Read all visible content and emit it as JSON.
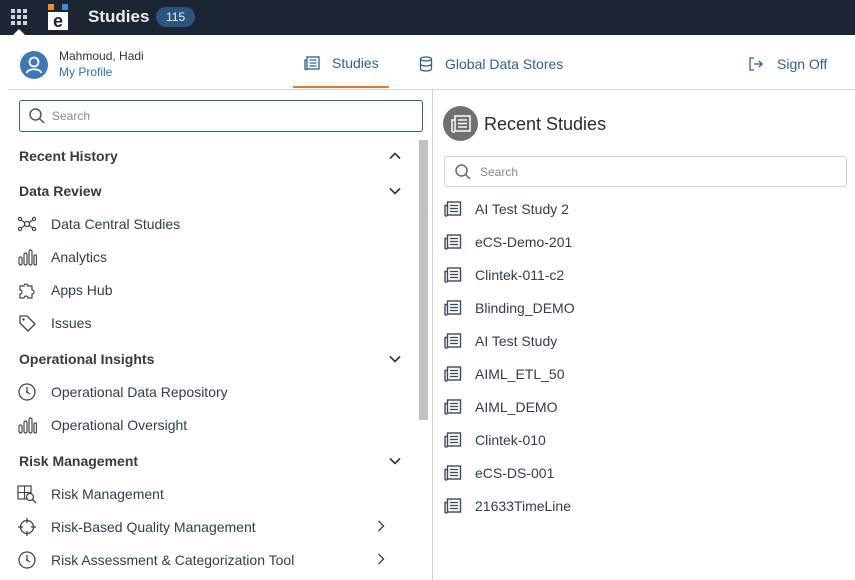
{
  "topbar": {
    "title": "Studies",
    "count": "115",
    "logo_letter": "e"
  },
  "header": {
    "user_name": "Mahmoud, Hadi",
    "profile_link": "My Profile",
    "tabs": [
      {
        "label": "Studies",
        "active": true,
        "icon": "studies-icon"
      },
      {
        "label": "Global Data Stores",
        "active": false,
        "icon": "database-icon"
      }
    ],
    "sign_off": "Sign Off"
  },
  "nav": {
    "search_placeholder": "Search",
    "sections": [
      {
        "label": "Recent History",
        "expanded": true,
        "items": []
      },
      {
        "label": "Data Review",
        "expanded": false,
        "items": [
          {
            "label": "Data Central Studies",
            "icon": "network-icon"
          },
          {
            "label": "Analytics",
            "icon": "bar-chart-icon"
          },
          {
            "label": "Apps Hub",
            "icon": "puzzle-icon"
          },
          {
            "label": "Issues",
            "icon": "tag-icon"
          }
        ]
      },
      {
        "label": "Operational Insights",
        "expanded": false,
        "items": [
          {
            "label": "Operational Data Repository",
            "icon": "gauge-icon"
          },
          {
            "label": "Operational Oversight",
            "icon": "bar-chart-icon"
          }
        ]
      },
      {
        "label": "Risk Management",
        "expanded": false,
        "items": [
          {
            "label": "Risk Management",
            "icon": "grid-search-icon"
          },
          {
            "label": "Risk-Based Quality Management",
            "icon": "crosshair-icon",
            "submenu": true
          },
          {
            "label": "Risk Assessment & Categorization Tool",
            "icon": "gauge-icon",
            "submenu": true
          }
        ]
      }
    ]
  },
  "recent": {
    "title": "Recent Studies",
    "search_placeholder": "Search",
    "studies": [
      "AI Test Study 2",
      "eCS-Demo-201",
      "Clintek-011-c2",
      "Blinding_DEMO",
      "AI Test Study",
      "AIML_ETL_50",
      "AIML_DEMO",
      "Clintek-010",
      "eCS-DS-001",
      "21633TimeLine"
    ]
  },
  "colors": {
    "topbar": "#1c2533",
    "accent": "#e8762c",
    "link": "#2e5f8a",
    "avatar": "#3d78b8"
  }
}
